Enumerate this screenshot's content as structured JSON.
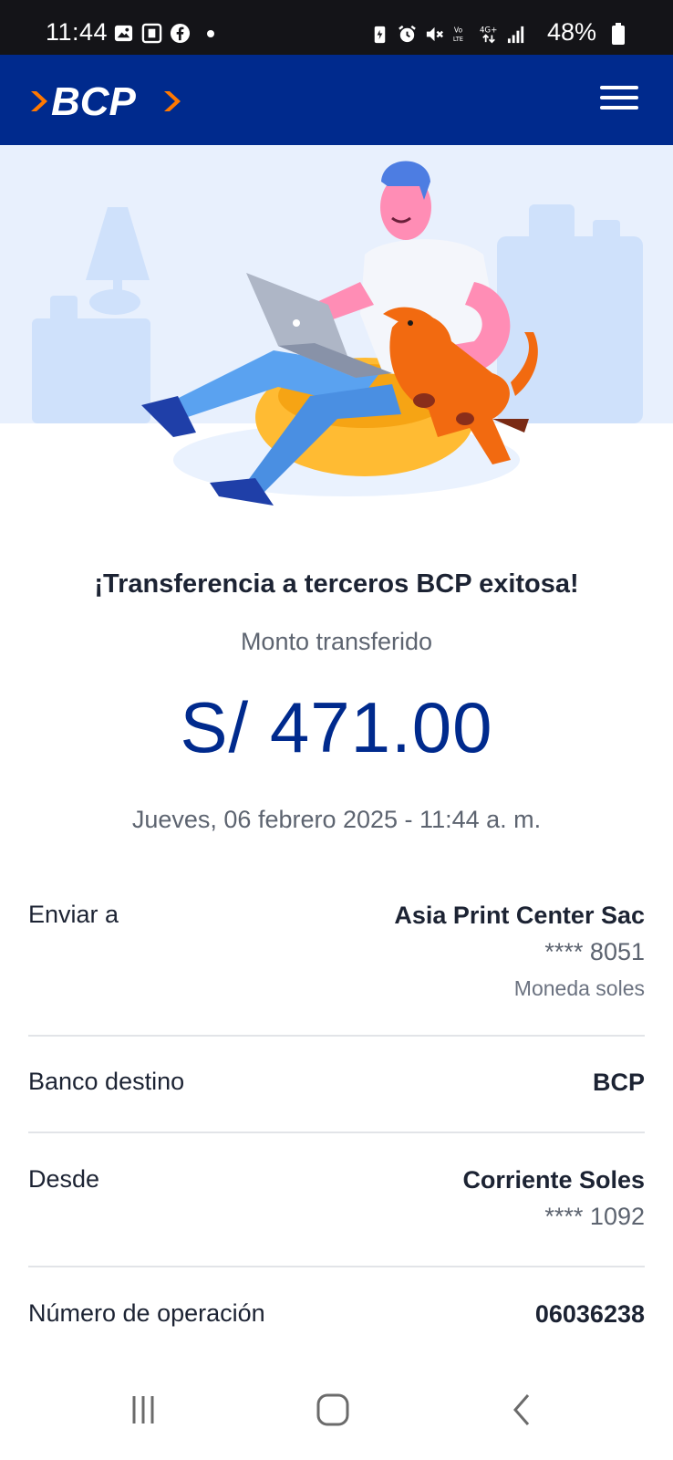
{
  "status_bar": {
    "time": "11:44",
    "battery": "48%"
  },
  "header": {
    "logo_text": "BCP",
    "menu_icon": "hamburger-menu-icon"
  },
  "success": {
    "title": "¡Transferencia a terceros BCP exitosa!",
    "subtitle": "Monto transferido",
    "amount": "S/ 471.00",
    "datetime": "Jueves, 06 febrero 2025 - 11:44 a. m."
  },
  "details": {
    "send_to": {
      "label": "Enviar a",
      "name": "Asia Print Center Sac",
      "account": "**** 8051",
      "currency": "Moneda soles"
    },
    "bank": {
      "label": "Banco destino",
      "value": "BCP"
    },
    "from": {
      "label": "Desde",
      "account_type": "Corriente Soles",
      "account": "**** 1092"
    },
    "operation": {
      "label": "Número de operación",
      "value": "06036238"
    }
  },
  "colors": {
    "brand_blue": "#002a8d",
    "brand_orange": "#ff7800"
  }
}
